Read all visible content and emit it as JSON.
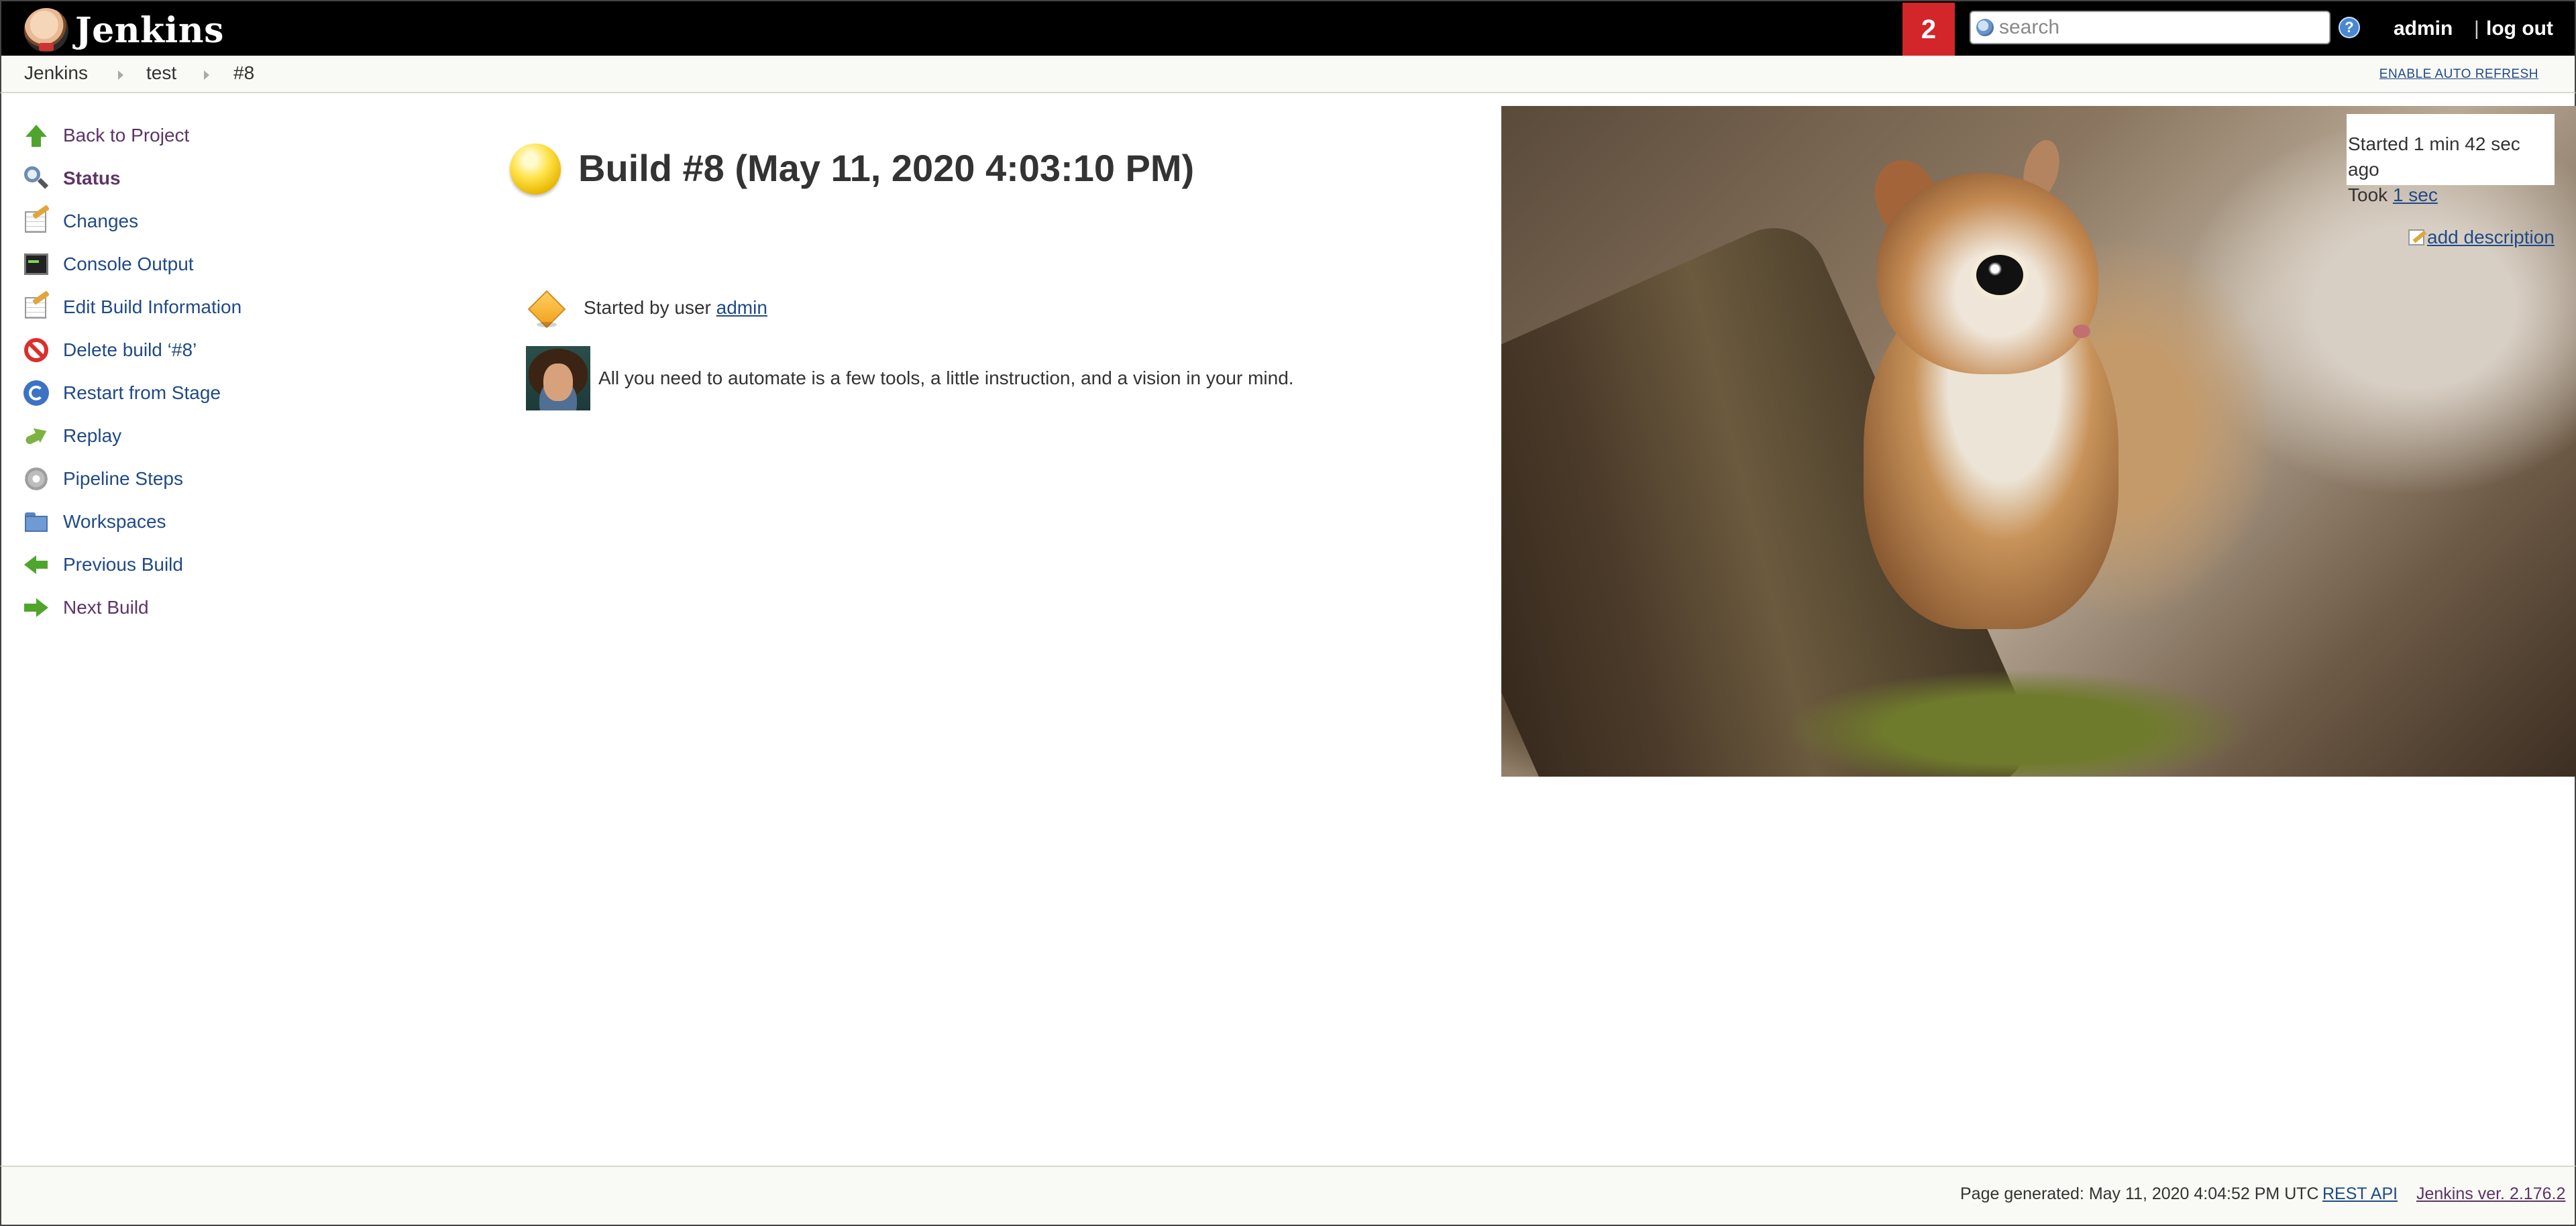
{
  "header": {
    "logo_text": "Jenkins",
    "notification_count": "2",
    "search_placeholder": "search",
    "help_label": "?",
    "user": "admin",
    "separator": "|",
    "logout": "log out"
  },
  "breadcrumb": {
    "items": [
      "Jenkins",
      "test",
      "#8"
    ],
    "auto_refresh": "ENABLE AUTO REFRESH"
  },
  "sidebar": {
    "items": [
      {
        "label": "Back to Project",
        "icon": "up-arrow-icon"
      },
      {
        "label": "Status",
        "icon": "magnifier-icon"
      },
      {
        "label": "Changes",
        "icon": "notepad-icon"
      },
      {
        "label": "Console Output",
        "icon": "terminal-icon"
      },
      {
        "label": "Edit Build Information",
        "icon": "notepad-icon"
      },
      {
        "label": "Delete build ‘#8’",
        "icon": "delete-icon"
      },
      {
        "label": "Restart from Stage",
        "icon": "restart-icon"
      },
      {
        "label": "Replay",
        "icon": "replay-icon"
      },
      {
        "label": "Pipeline Steps",
        "icon": "gear-icon"
      },
      {
        "label": "Workspaces",
        "icon": "folder-icon"
      },
      {
        "label": "Previous Build",
        "icon": "left-arrow-icon"
      },
      {
        "label": "Next Build",
        "icon": "right-arrow-icon"
      }
    ]
  },
  "main": {
    "title": "Build #8 (May 11, 2020 4:03:10 PM)",
    "cause_prefix": "Started by user",
    "cause_user": "admin",
    "quote": "All you need to automate is a few tools, a little instruction, and a vision in your mind."
  },
  "build_info": {
    "started": "Started 1 min 42 sec ago",
    "took_prefix": "Took",
    "took_value": "1 sec",
    "add_description": "add description"
  },
  "footer": {
    "generated": "Page generated: May 11, 2020 4:04:52 PM UTC",
    "rest_api": "REST API",
    "version": "Jenkins ver. 2.176.2"
  },
  "colors": {
    "header_bg": "#000000",
    "alert_red": "#d2262a",
    "link_blue": "#204a87",
    "visited_purple": "#5c3566",
    "status_yellow": "#ffe34a"
  }
}
